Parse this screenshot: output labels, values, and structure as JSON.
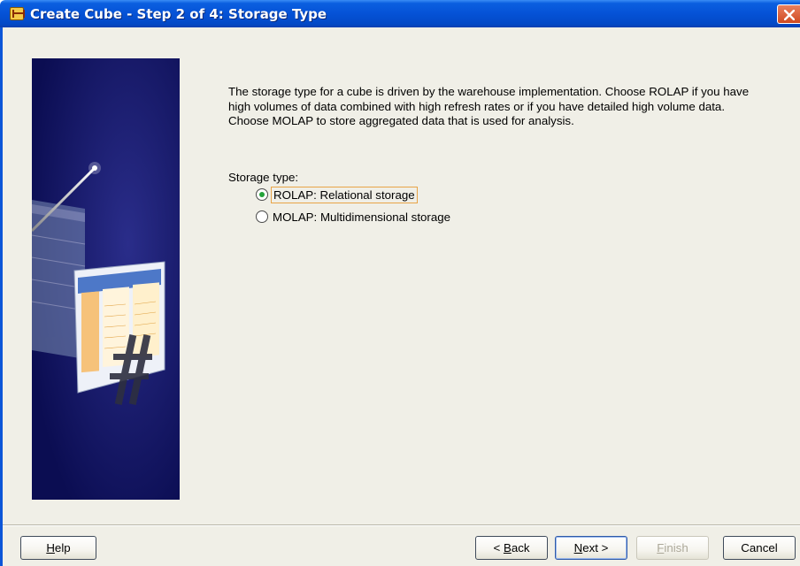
{
  "window": {
    "title": "Create Cube - Step 2 of 4: Storage Type"
  },
  "content": {
    "description": "The storage type for a cube is driven by the warehouse implementation. Choose ROLAP if you have high volumes of data combined with high refresh rates or if you have detailed high volume data. Choose MOLAP to store aggregated data that is used for analysis.",
    "storage_type_label": "Storage type:",
    "options": [
      {
        "label": "ROLAP: Relational storage",
        "selected": true
      },
      {
        "label": "MOLAP: Multidimensional storage",
        "selected": false
      }
    ]
  },
  "buttons": {
    "help": {
      "mnemonic": "H",
      "rest": "elp"
    },
    "back": {
      "prefix": "< ",
      "mnemonic": "B",
      "rest": "ack"
    },
    "next": {
      "mnemonic": "N",
      "rest": "ext >"
    },
    "finish": {
      "mnemonic": "F",
      "rest": "inish",
      "enabled": false
    },
    "cancel": {
      "label": "Cancel"
    }
  },
  "colors": {
    "title_bar": "#0552d6",
    "dialog_background": "#f0efe7",
    "side_panel": "#0d0f58",
    "radio_selected": "#24a33a",
    "focus_border": "#e8a448"
  },
  "icons": {
    "app": "oracle-wizard-icon",
    "close": "close-icon",
    "side_art": "magic-wand-table-illustration"
  }
}
